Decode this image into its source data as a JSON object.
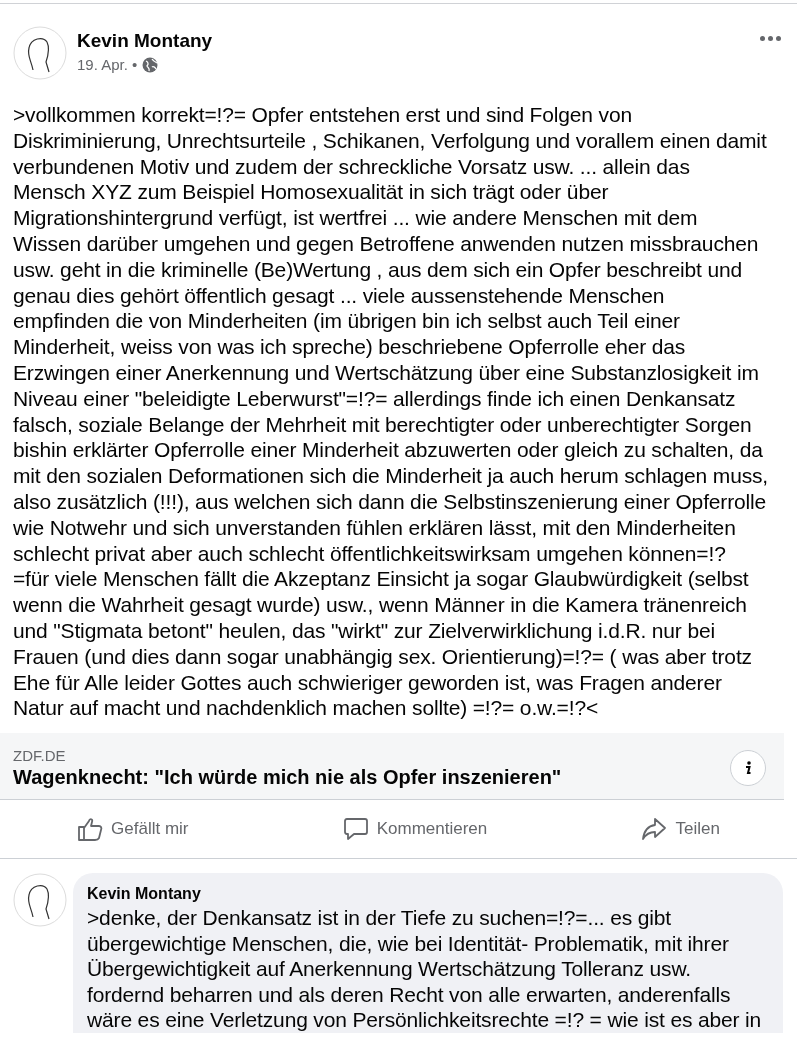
{
  "post": {
    "author": "Kevin Montany",
    "date": "19. Apr. •",
    "text": ">vollkommen korrekt=!?= Opfer entstehen erst und sind Folgen von\nDiskriminierung, Unrechtsurteile , Schikanen, Verfolgung  und vorallem einen damit\nverbundenen Motiv und zudem der schreckliche Vorsatz usw.  ... allein das\nMensch XYZ zum Beispiel Homosexualität in sich trägt oder über\nMigrationshintergrund verfügt, ist wertfrei ... wie andere Menschen mit dem\nWissen darüber umgehen und gegen Betroffene anwenden nutzen missbrauchen\nusw. geht in die kriminelle (Be)Wertung , aus dem sich ein Opfer beschreibt und\ngenau dies gehört öffentlich gesagt ... viele aussenstehende Menschen\nempfinden die von Minderheiten (im übrigen bin ich selbst auch Teil einer\nMinderheit, weiss von was ich spreche) beschriebene  Opferrolle eher das\nErzwingen einer Anerkennung und Wertschätzung über eine Substanzlosigkeit im\nNiveau einer \"beleidigte Leberwurst\"=!?= allerdings finde ich einen Denkansatz\nfalsch, soziale Belange der Mehrheit mit berechtigter oder unberechtigter  Sorgen\nbishin erklärter Opferrolle einer Minderheit abzuwerten oder gleich zu schalten, da\nmit den sozialen Deformationen sich die Minderheit ja auch herum schlagen muss,\nalso zusätzlich (!!!), aus welchen sich dann die Selbstinszenierung einer Opferrolle\nwie Notwehr und sich unverstanden fühlen erklären lässt, mit den Minderheiten\nschlecht privat aber auch schlecht öffentlichkeitswirksam umgehen können=!?\n=für viele Menschen fällt die Akzeptanz Einsicht ja sogar Glaubwürdigkeit (selbst\nwenn die Wahrheit gesagt wurde) usw., wenn Männer in die Kamera tränenreich\nund \"Stigmata betont\" heulen, das \"wirkt\" zur Zielverwirklichung i.d.R.  nur bei\nFrauen (und dies dann sogar unabhängig sex. Orientierung)=!?=  ( was aber trotz\nEhe für Alle  leider Gottes auch schwieriger geworden ist, was Fragen anderer\nNatur auf macht und nachdenklich machen sollte)  =!?= o.w.=!?<"
  },
  "link_preview": {
    "source": "ZDF.DE",
    "title": "Wagenknecht: \"Ich würde mich nie als Opfer inszenieren\""
  },
  "actions": [
    {
      "kind": "like",
      "label": "Gefällt mir"
    },
    {
      "kind": "comment",
      "label": "Kommentieren"
    },
    {
      "kind": "share",
      "label": "Teilen"
    }
  ],
  "comments": [
    {
      "author": "Kevin Montany",
      "text": ">denke, der Denkansatz ist in der Tiefe zu suchen=!?=... es gibt\nübergewichtige Menschen,  die, wie bei Identität- Problematik, mit ihrer\nÜbergewichtigkeit auf Anerkennung Wertschätzung Tolleranz usw.\nfordernd beharren und als deren Recht von alle erwarten, anderenfalls\nwäre es eine Verletzung von Persönlichkeitsrechte =!? = wie ist es aber in"
    }
  ]
}
